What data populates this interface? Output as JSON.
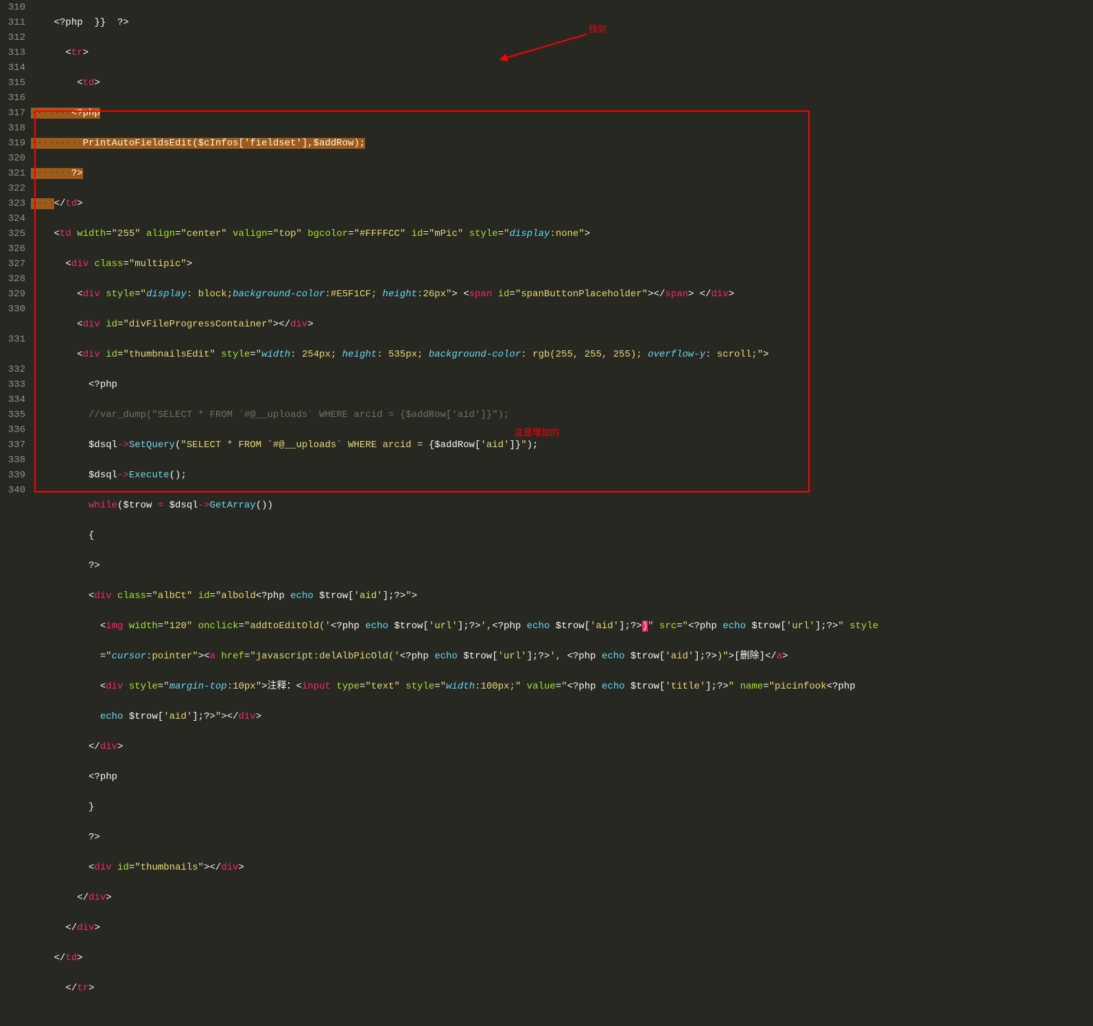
{
  "lineNumbers": [
    "310",
    "311",
    "312",
    "313",
    "314",
    "315",
    "316",
    "317",
    "318",
    "319",
    "320",
    "321",
    "322",
    "323",
    "324",
    "325",
    "326",
    "327",
    "328",
    "329",
    "330",
    "",
    "331",
    "",
    "332",
    "333",
    "334",
    "335",
    "336",
    "337",
    "338",
    "339",
    "340"
  ],
  "annotations": {
    "found": "找到",
    "added": "这是增加的"
  },
  "code": {
    "l310": "<?php  }}  ?>",
    "l311": "<tr>",
    "l312": "<td>",
    "l313_dots": "·······",
    "l313_php": "<?php",
    "l314_dots": "·········",
    "l314_code": "PrintAutoFieldsEdit($cInfos['fieldset'],$addRow);",
    "l315_dots": "·······",
    "l315_php": "?>",
    "l316_dots": "····",
    "l316_tag": "</td>",
    "l317": {
      "tag": "td",
      "attrs": {
        "width": "255",
        "align": "center",
        "valign": "top",
        "bgcolor": "#FFFFCC",
        "id": "mPic",
        "style": "display:none"
      }
    },
    "l318": {
      "tag": "div",
      "class": "multipic"
    },
    "l319": {
      "tag": "div",
      "style": "display: block;background-color:#E5F1CF; height:26px",
      "inner_tag": "span",
      "inner_id": "spanButtonPlaceholder"
    },
    "l320": {
      "tag": "div",
      "id": "divFileProgressContainer"
    },
    "l321": {
      "tag": "div",
      "id": "thumbnailsEdit",
      "style": "width: 254px; height: 535px; background-color: rgb(255, 255, 255); overflow-y: scroll;"
    },
    "l322": "<?php",
    "l323": "//var_dump(\"SELECT * FROM `#@__uploads` WHERE arcid = {$addRow['aid']}\");",
    "l324": "$dsql->SetQuery(\"SELECT * FROM `#@__uploads` WHERE arcid = {$addRow['aid']}\");",
    "l325": "$dsql->Execute();",
    "l326": "while($trow = $dsql->GetArray())",
    "l327": "{",
    "l328": "?>",
    "l329": {
      "tag": "div",
      "class": "albCt",
      "id_prefix": "albold",
      "php_echo": "<?php echo $trow['aid'];?>"
    },
    "l330": {
      "tag": "img",
      "width": "120",
      "onclick_func": "addtoEditOld",
      "url_echo": "<?php echo $trow['url'];?>",
      "aid_echo": "<?php echo $trow['aid'];?>",
      "style": "cursor:pointer",
      "a_href_func": "javascript:delAlbPicOld",
      "delete_text": "[删除]"
    },
    "l331": {
      "tag": "div",
      "style": "margin-top:10px",
      "label": "注释：",
      "input_type": "text",
      "input_style": "width:100px;",
      "value_echo": "<?php echo $trow['title'];?>",
      "name_prefix": "picinfook",
      "name_echo": "<?php echo $trow['aid'];?>"
    },
    "l332": "</div>",
    "l333": "<?php",
    "l334": "}",
    "l335": "?>",
    "l336": {
      "tag": "div",
      "id": "thumbnails"
    },
    "l337": "</div>",
    "l338": "</div>",
    "l339": "</td>",
    "l340": "</tr>"
  }
}
